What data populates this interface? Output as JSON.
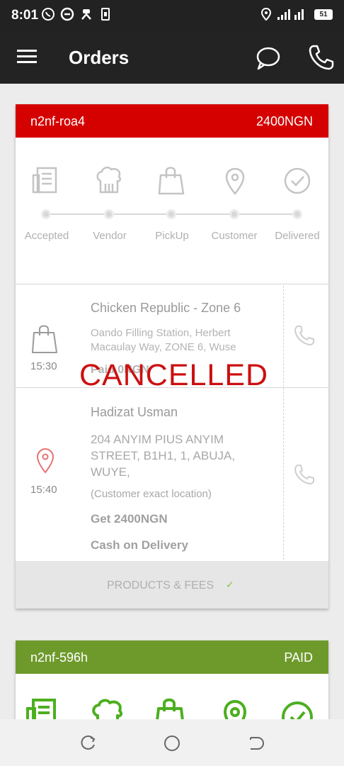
{
  "status_bar": {
    "time": "8:01",
    "battery": "51"
  },
  "app_bar": {
    "title": "Orders"
  },
  "order1": {
    "id": "n2nf-roa4",
    "amount": "2400NGN",
    "steps": [
      "Accepted",
      "Vendor",
      "PickUp",
      "Customer",
      "Delivered"
    ],
    "vendor": {
      "time": "15:30",
      "name": "Chicken Republic - Zone 6",
      "address": "Oando Filling Station, Herbert Macaulay Way, ZONE 6, Wuse",
      "paid": "Paid 0NGN"
    },
    "customer": {
      "time": "15:40",
      "name": "Hadizat Usman",
      "address": "204 ANYIM PIUS ANYIM STREET, B1H1, 1, ABUJA, WUYE,",
      "location_note": "(Customer exact location)",
      "get": "Get 2400NGN",
      "payment": "Cash on Delivery"
    },
    "status_overlay": "CANCELLED",
    "products_fees_label": "PRODUCTS & FEES",
    "products_fees_check": "✓"
  },
  "order2": {
    "id": "n2nf-596h",
    "status": "PAID"
  },
  "colors": {
    "cancelled_header": "#d50000",
    "paid_header": "#6e9a2b",
    "cancelled_text": "#cc0f0f",
    "accent_green": "#4caf1f"
  }
}
